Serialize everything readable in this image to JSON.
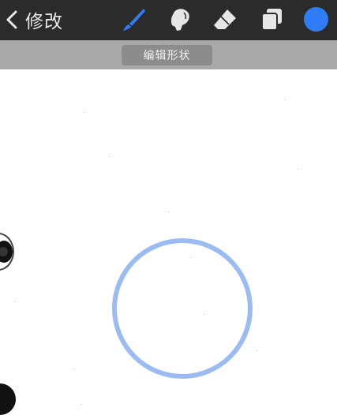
{
  "topbar": {
    "back_label": "修改",
    "color_hex": "#2e7cf6"
  },
  "tools": [
    {
      "name": "brush-icon",
      "active": true,
      "color": "#2e7cf6"
    },
    {
      "name": "smudge-icon",
      "active": false,
      "color": "#e6e6e6"
    },
    {
      "name": "eraser-icon",
      "active": false,
      "color": "#e6e6e6"
    },
    {
      "name": "layers-icon",
      "active": false,
      "color": "#e6e6e6"
    }
  ],
  "subbar": {
    "edit_shape_label": "编辑形状"
  },
  "canvas": {
    "shape": "circle",
    "shape_color": "#9bbcf2"
  }
}
